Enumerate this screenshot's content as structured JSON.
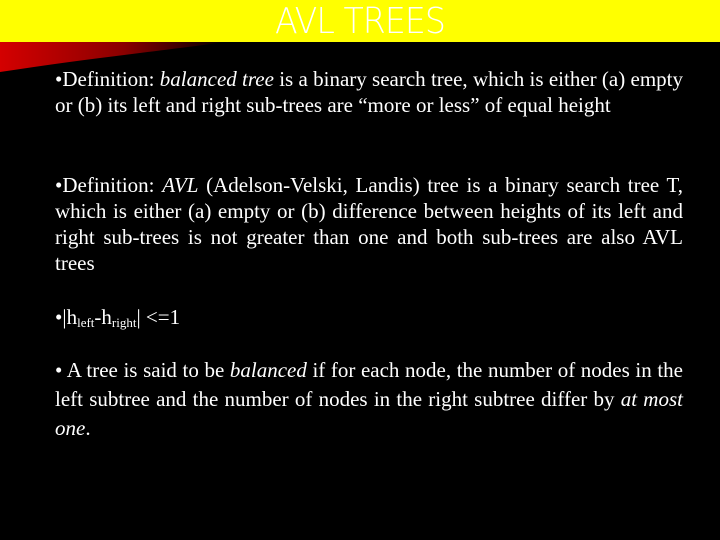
{
  "slide": {
    "title": "AVL TREES",
    "colors": {
      "title_band": "#ffff00",
      "background": "#000000",
      "accent_swoosh": "#cc0000",
      "text": "#ffffff"
    }
  },
  "bullets": [
    {
      "bullet": "•",
      "prefix": "Definition: ",
      "term": "balanced tree",
      "rest": " is a binary search tree, which is either (a) empty or (b) its left and right sub-trees are “more or less” of equal height"
    },
    {
      "bullet": "•",
      "prefix": "Definition: ",
      "term": "AVL",
      "rest": " (Adelson-Velski, Landis) tree is a binary search tree T, which is  either (a) empty or (b) difference between heights of its left and right sub-trees is not greater than one and both sub-trees are also AVL trees"
    },
    {
      "bullet": "•",
      "formula": {
        "open": "|h",
        "sub1": "left",
        "mid": "-h",
        "sub2": "right",
        "close": "| <=1"
      }
    },
    {
      "bullet": "• ",
      "prefix": "A tree is said to be ",
      "term": "balanced",
      "middle": " if for each node, the number of nodes in the left subtree and the number of nodes in the right subtree differ by ",
      "term2": "at most one",
      "end": "."
    }
  ]
}
